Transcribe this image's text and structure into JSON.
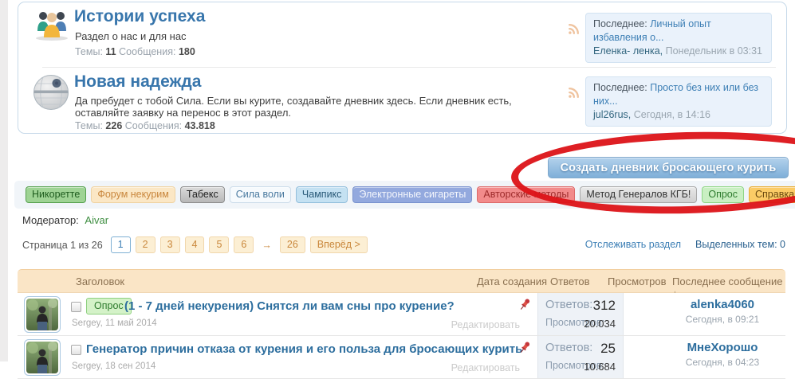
{
  "sections": [
    {
      "title": "Истории успеха",
      "description": "Раздел о нас и для нас",
      "topics_label": "Темы:",
      "topics": "11",
      "posts_label": "Сообщения:",
      "posts": "180",
      "last_label": "Последнее:",
      "last_topic": "Личный опыт избавления о...",
      "last_author": "Еленка- ленка",
      "last_sep": ", ",
      "last_time": "Понедельник в 03:31"
    },
    {
      "title": "Новая надежда",
      "description": "Да пребудет с тобой Сила. Если вы курите, создавайте дневник здесь. Если дневник есть, оставляйте заявку на перенос в этот раздел.",
      "topics_label": "Темы:",
      "topics": "226",
      "posts_label": "Сообщения:",
      "posts": "43.818",
      "last_label": "Последнее:",
      "last_topic": "Просто без них или без них...",
      "last_author": "jul26rus",
      "last_sep": ", ",
      "last_time": "Сегодня, в 14:16"
    }
  ],
  "create_button": {
    "label": "Создать дневник бросающего курить",
    "accent": "#7FAFD8"
  },
  "annotation": {
    "shape": "hand-drawn ellipse",
    "color": "#DC1318"
  },
  "tags": [
    {
      "label": "Никоретте",
      "bg": "#9ED394",
      "color": "#1E5C1E"
    },
    {
      "label": "Форум некурим",
      "bg": "#FBE7C5",
      "color": "#C9873D"
    },
    {
      "label": "Табекс",
      "bg": "#C9C9C9",
      "color": "#222222"
    },
    {
      "label": "Сила воли",
      "bg": "#F6FAFD",
      "color": "#49799F"
    },
    {
      "label": "Чампикс",
      "bg": "#C4E1F2",
      "color": "#2A5A78"
    },
    {
      "label": "Электронные сигареты",
      "bg": "#93A9DE",
      "color": "#F4F6FC"
    },
    {
      "label": "Авторские методы",
      "bg": "#F28B8B",
      "color": "#9E2B2B"
    },
    {
      "label": "Метод Генералов КГБ!",
      "bg": "#DCDCDC",
      "color": "#333333"
    },
    {
      "label": "Опрос",
      "bg": "#C9EFC2",
      "color": "#2C7A2C"
    },
    {
      "label": "Справка",
      "bg": "#FBCB66",
      "color": "#6B4A10"
    }
  ],
  "moderator": {
    "label": "Модератор:",
    "name": "Aivar"
  },
  "pagination": {
    "page_label": "Страница 1 из 26",
    "current": "1",
    "pages": [
      "2",
      "3",
      "4",
      "5",
      "6"
    ],
    "gap_arrow": "→",
    "last_page": "26",
    "next_label": "Вперёд >"
  },
  "section_actions": {
    "follow": "Отслеживать раздел",
    "selected": "Выделенных тем: 0"
  },
  "table": {
    "headers": {
      "title": "Заголовок",
      "created": "Дата создания",
      "replies": "Ответов",
      "views": "Просмотров",
      "last_post": "Последнее сообщение ↓"
    },
    "rows": [
      {
        "badge": "Опрос",
        "title": "(1 - 7 дней некурения) Снятся ли вам сны про курение?",
        "author_date": "Sergey, 11 май 2014",
        "edit_label": "Редактировать",
        "replies_label": "Ответов:",
        "replies": "312",
        "views_label": "Просмотров:",
        "views": "20.034",
        "last_author": "alenka4060",
        "last_time": "Сегодня, в 09:21"
      },
      {
        "title": "Генератор причин отказа от курения и его польза для бросающих курить",
        "author_date": "Sergey, 18 сен 2014",
        "edit_label": "Редактировать",
        "replies_label": "Ответов:",
        "replies": "25",
        "views_label": "Просмотров:",
        "views": "10.684",
        "last_author": "МнеХорошо",
        "last_time": "Сегодня, в 04:23"
      }
    ]
  }
}
